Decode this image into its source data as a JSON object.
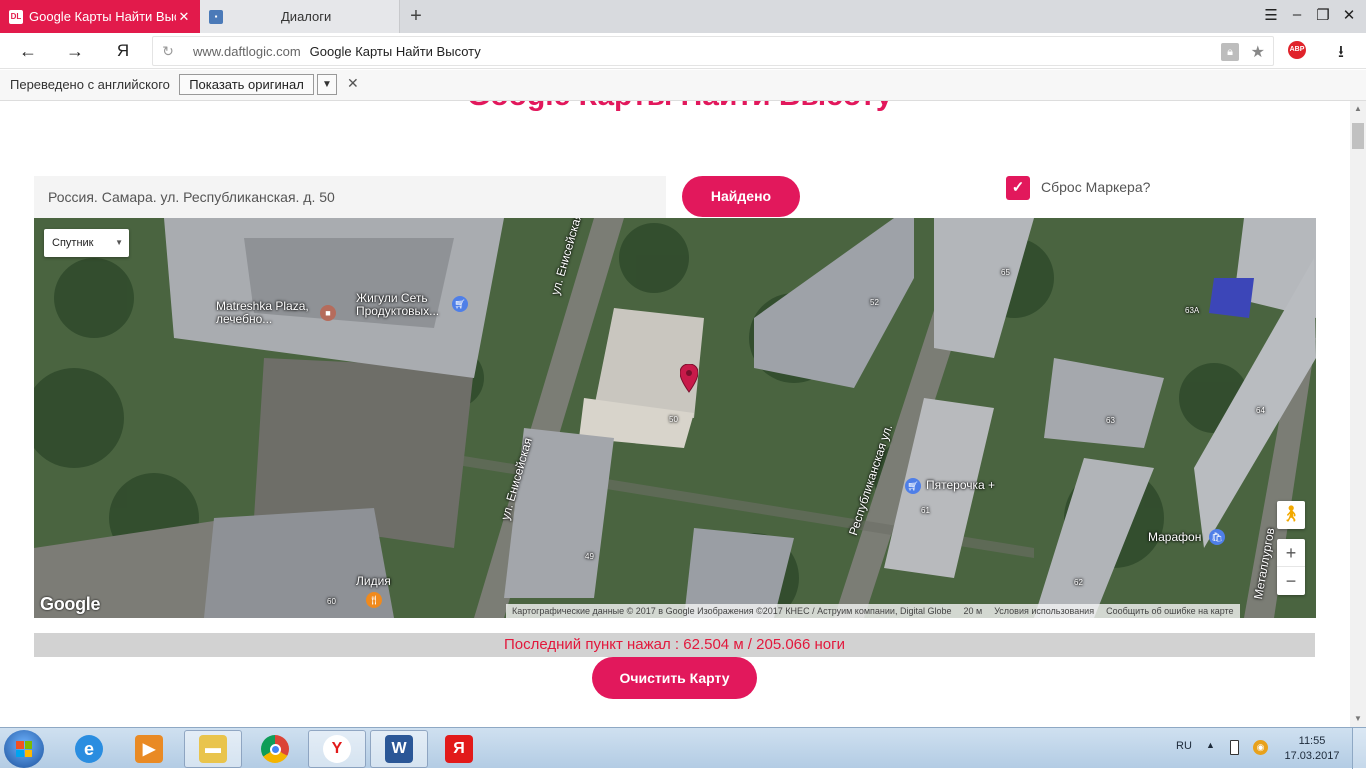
{
  "browser": {
    "tabs": [
      {
        "favicon": "DL",
        "label": "Google Карты Найти Высоту",
        "active": true
      },
      {
        "favicon": "chat-icon",
        "label": "Диалоги",
        "active": false
      }
    ],
    "url_domain": "www.daftlogic.com",
    "url_title": "Google Карты Найти Высоту",
    "yandex_button": "Я",
    "adblock_badge": "ABP"
  },
  "translate_bar": {
    "label": "Переведено с английского",
    "show_original": "Показать оригинал"
  },
  "page": {
    "heading": "Google Карты Найти Высоту",
    "search_value": "Россия. Самара. ул. Республиканская. д. 50",
    "find_button": "Найдено",
    "reset_marker_label": "Сброс Маркера?",
    "reset_marker_checked": true,
    "result_text": "Последний пункт нажал : 62.504 м / 205.066 ноги",
    "clear_button": "Очистить Карту",
    "accent_color": "#e2185c"
  },
  "map": {
    "map_type": "Спутник",
    "logo": "Google",
    "attribution": "Картографические данные © 2017 в Google Изображения ©2017 КНЕС / Аструим компании, Digital Globe",
    "scale": "20 м",
    "terms": "Условия использования",
    "report": "Сообщить об ошибке на карте",
    "zoom_in": "+",
    "zoom_out": "−",
    "labels": {
      "matreshka": "Matreshka Plaza, лечебно...",
      "zhiguli": "Жигули Сеть Продуктовых...",
      "enis1": "ул. Енисейская",
      "enis2": "ул. Енисейская",
      "respub": "Республиканская ул.",
      "pyaterochka": "Пятерочка +",
      "marafon": "Марафон",
      "lidia": "Лидия",
      "metal": "Металлургов",
      "n50": "50",
      "n52": "52",
      "n65": "65",
      "n63a": "63А",
      "n63": "63",
      "n64": "64",
      "n61": "61",
      "n49": "49",
      "n60": "60",
      "n62": "62"
    }
  },
  "taskbar": {
    "lang": "RU",
    "time": "11:55",
    "date": "17.03.2017"
  }
}
